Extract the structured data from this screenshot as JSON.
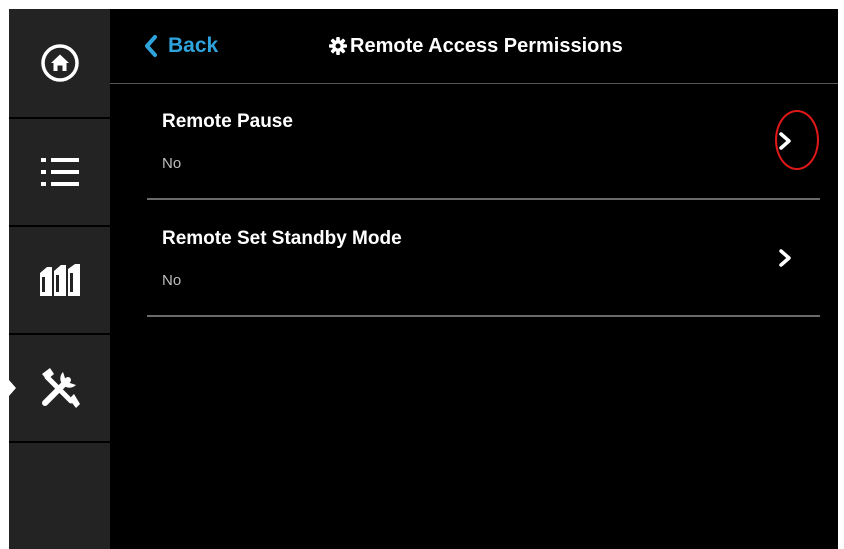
{
  "sidebar": {
    "items": [
      {
        "id": "home",
        "icon": "home-icon"
      },
      {
        "id": "list",
        "icon": "list-icon"
      },
      {
        "id": "jobs",
        "icon": "cartridges-icon"
      },
      {
        "id": "tools",
        "icon": "tools-icon",
        "active": true
      },
      {
        "id": "empty",
        "icon": ""
      }
    ]
  },
  "header": {
    "back_label": "Back",
    "title": "Remote Access Permissions",
    "title_icon": "gear-icon"
  },
  "permissions": [
    {
      "label": "Remote Pause",
      "value": "No",
      "highlighted": true
    },
    {
      "label": "Remote Set Standby Mode",
      "value": "No",
      "highlighted": false
    }
  ],
  "colors": {
    "background": "#000000",
    "sidebar": "#232323",
    "accent": "#2ea3dc",
    "highlight": "#e01818",
    "divider": "#6a6a6a"
  }
}
